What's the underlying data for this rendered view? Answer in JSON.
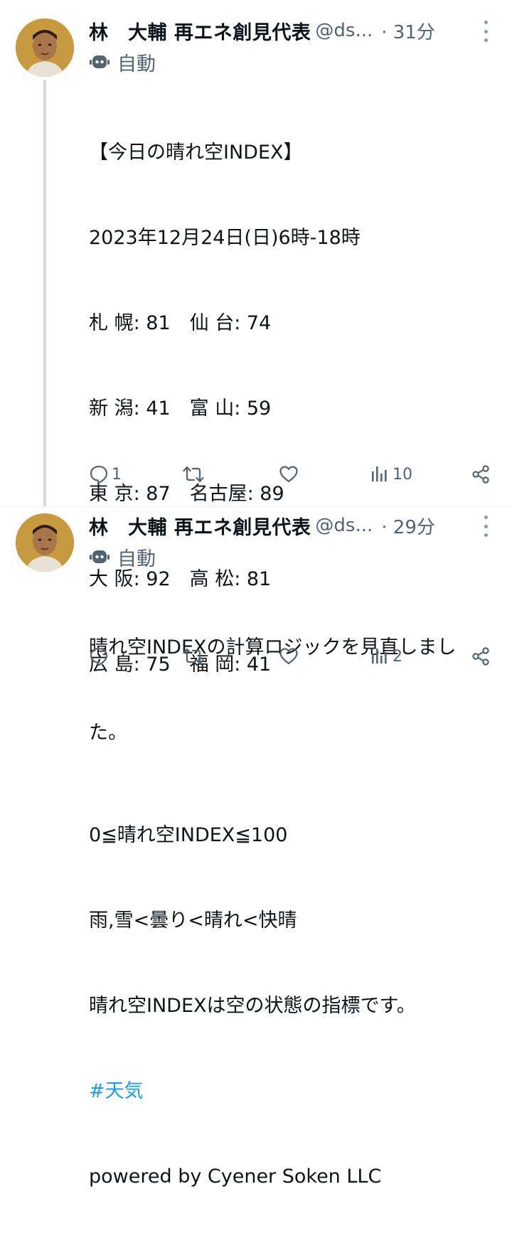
{
  "tweets": [
    {
      "name": "林　大輔 再エネ創見代表",
      "handle": "@ds...",
      "time": "· 31分",
      "automated": "自動",
      "lines": [
        "【今日の晴れ空INDEX】",
        "2023年12月24日(日)6時-18時",
        "札 幌: 81　仙 台: 74",
        "新 潟: 41　富 山: 59",
        "東 京: 87　名古屋: 89",
        "大 阪: 92　高 松: 81",
        "広 島: 75　福 岡: 41",
        "",
        "0≦晴れ空INDEX≦100",
        "雨,雪<曇り<晴れ<快晴",
        "晴れ空INDEXは空の状態の指標です。"
      ],
      "hashtag": "#天気",
      "footer": "powered by Cyener Soken LLC",
      "replies": "1",
      "retweets": "",
      "likes": "",
      "views": "10"
    },
    {
      "name": "林　大輔 再エネ創見代表",
      "handle": "@ds...",
      "time": "· 29分",
      "automated": "自動",
      "lines": [
        "晴れ空INDEXの計算ロジックを見直しまし",
        "た。"
      ],
      "replies": "",
      "retweets": "",
      "likes": "",
      "views": "2"
    }
  ],
  "colors": {
    "text": "#0f1419",
    "secondary": "#536471",
    "hashtag": "#1d9bf0",
    "thread_line": "#cfd9de"
  },
  "icons": [
    "robot-icon",
    "more-icon",
    "reply-icon",
    "retweet-icon",
    "like-icon",
    "views-icon",
    "share-icon"
  ]
}
